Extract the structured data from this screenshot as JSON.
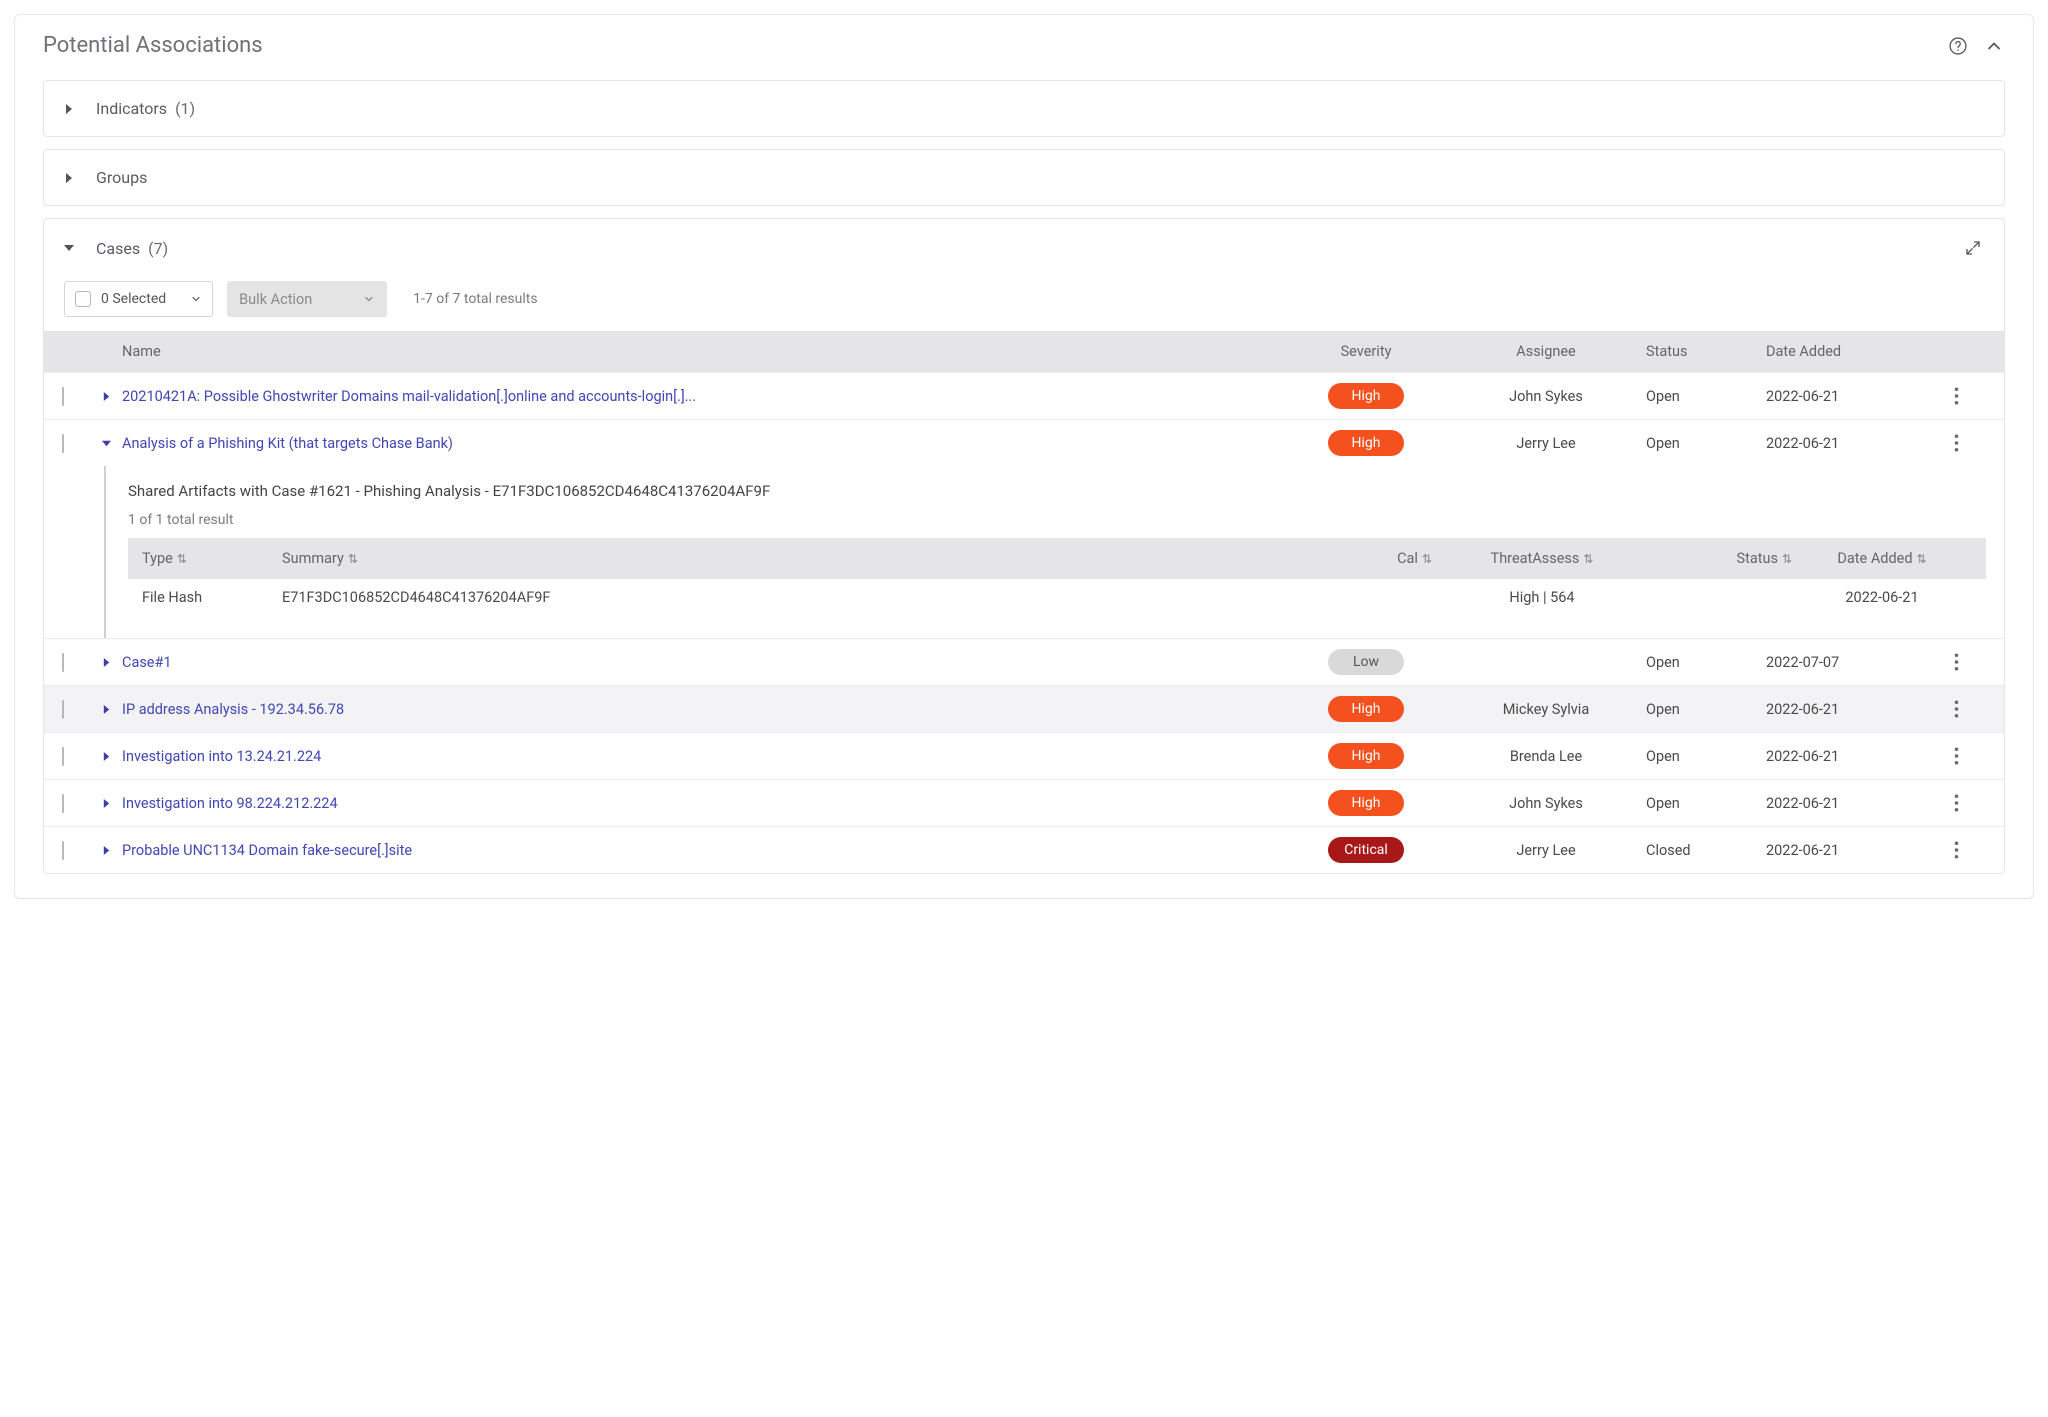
{
  "header": {
    "title": "Potential Associations"
  },
  "panels": {
    "indicators": {
      "label": "Indicators",
      "count": "(1)"
    },
    "groups": {
      "label": "Groups",
      "count": ""
    },
    "cases": {
      "label": "Cases",
      "count": "(7)"
    }
  },
  "toolbar": {
    "selected_label": "0 Selected",
    "bulk_label": "Bulk Action",
    "results_label": "1-7 of 7 total results"
  },
  "columns": {
    "name": "Name",
    "severity": "Severity",
    "assignee": "Assignee",
    "status": "Status",
    "date": "Date Added"
  },
  "rows": [
    {
      "name": "20210421A: Possible Ghostwriter Domains mail-validation[.]online and accounts-login[.]...",
      "severity": "High",
      "sev_class": "high",
      "assignee": "John Sykes",
      "status": "Open",
      "date": "2022-06-21",
      "expanded": false
    },
    {
      "name": "Analysis of a Phishing Kit (that targets Chase Bank)",
      "severity": "High",
      "sev_class": "high",
      "assignee": "Jerry Lee",
      "status": "Open",
      "date": "2022-06-21",
      "expanded": true
    },
    {
      "name": "Case#1",
      "severity": "Low",
      "sev_class": "low",
      "assignee": "",
      "status": "Open",
      "date": "2022-07-07",
      "expanded": false
    },
    {
      "name": "IP address Analysis - 192.34.56.78",
      "severity": "High",
      "sev_class": "high",
      "assignee": "Mickey Sylvia",
      "status": "Open",
      "date": "2022-06-21",
      "expanded": false,
      "alt": true
    },
    {
      "name": "Investigation into 13.24.21.224",
      "severity": "High",
      "sev_class": "high",
      "assignee": "Brenda Lee",
      "status": "Open",
      "date": "2022-06-21",
      "expanded": false
    },
    {
      "name": "Investigation into 98.224.212.224",
      "severity": "High",
      "sev_class": "high",
      "assignee": "John Sykes",
      "status": "Open",
      "date": "2022-06-21",
      "expanded": false
    },
    {
      "name": "Probable UNC1134 Domain fake-secure[.]site",
      "severity": "Critical",
      "sev_class": "critical",
      "assignee": "Jerry Lee",
      "status": "Closed",
      "date": "2022-06-21",
      "expanded": false
    }
  ],
  "sub": {
    "title": "Shared Artifacts with Case #1621 - Phishing Analysis - E71F3DC106852CD4648C41376204AF9F",
    "results_label": "1 of 1 total result",
    "columns": {
      "type": "Type",
      "summary": "Summary",
      "cal": "Cal",
      "threat": "ThreatAssess",
      "status": "Status",
      "date": "Date Added"
    },
    "rows": [
      {
        "type": "File Hash",
        "summary": "E71F3DC106852CD4648C41376204AF9F",
        "cal": "",
        "threat": "High | 564",
        "status": "",
        "date": "2022-06-21"
      }
    ]
  }
}
